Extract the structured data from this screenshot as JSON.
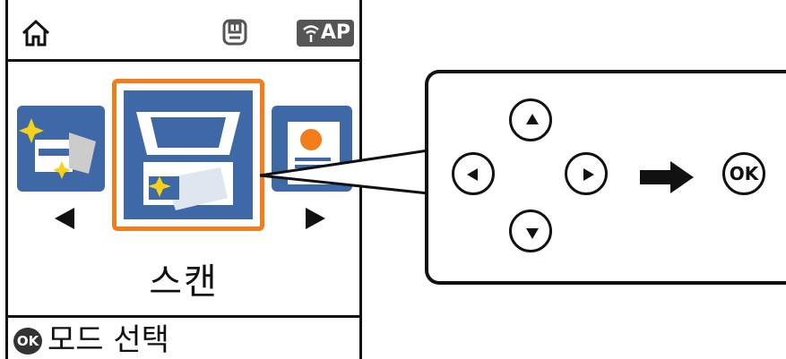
{
  "status": {
    "ap_label": "AP"
  },
  "mode": {
    "label": "스캔"
  },
  "footer": {
    "ok_badge": "OK",
    "hint": "모드 선택"
  },
  "callout": {
    "ok_label": "OK"
  },
  "colors": {
    "tile_blue": "#3f68a6",
    "selection_orange": "#f37d1a"
  }
}
